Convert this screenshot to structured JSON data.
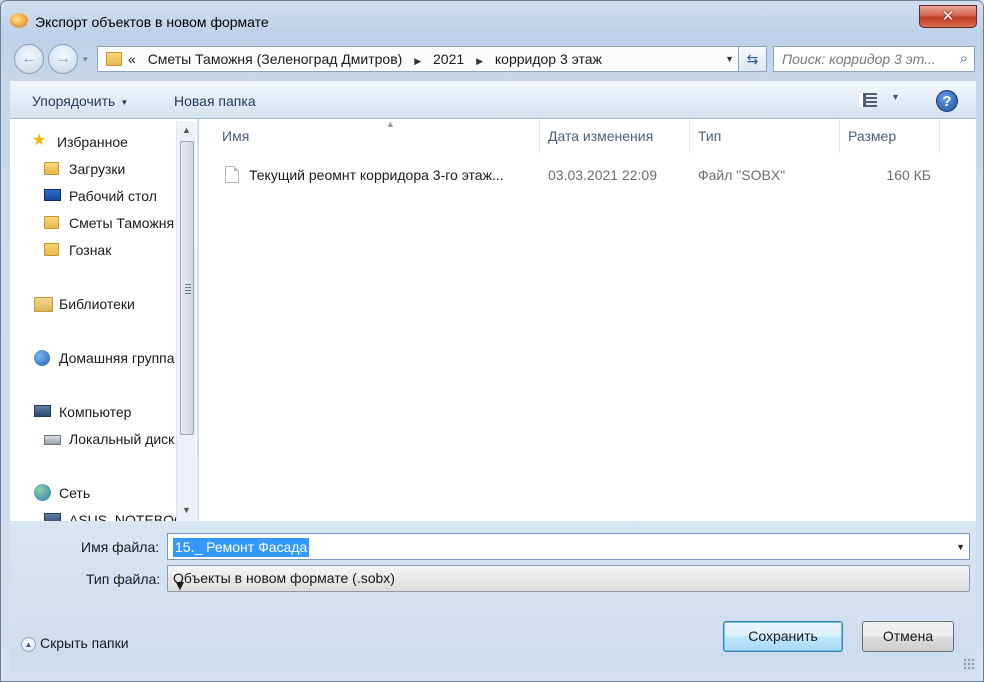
{
  "window": {
    "title": "Экспорт объектов в новом формате",
    "close_glyph": "✕",
    "accent": "#c23b25"
  },
  "nav": {
    "back_glyph": "←",
    "fwd_glyph": "→",
    "dropdown_glyph": "▾"
  },
  "address": {
    "overflow": "«",
    "crumbs": [
      "Сметы Таможня (Зеленоград Дмитров)",
      "2021",
      "корридор 3 этаж"
    ],
    "sep": "▶",
    "dropdown_glyph": "▼",
    "refresh_glyph": "⇆"
  },
  "search": {
    "placeholder": "Поиск: корридор 3 эт...",
    "icon_glyph": "⌕"
  },
  "toolbar": {
    "organize": "Упорядочить",
    "organize_caret": "▼",
    "new_folder": "Новая папка",
    "view_caret": "▼",
    "help_glyph": "?"
  },
  "sidebar": {
    "items": [
      {
        "label": "Избранное",
        "icon": "star-icon"
      },
      {
        "label": "Загрузки",
        "icon": "folder-icon"
      },
      {
        "label": "Рабочий стол",
        "icon": "desktop-icon"
      },
      {
        "label": "Сметы Таможня",
        "icon": "folder-icon"
      },
      {
        "label": "Гознак",
        "icon": "folder-icon"
      },
      {
        "label": "Библиотеки",
        "icon": "libraries-icon"
      },
      {
        "label": "Домашняя группа",
        "icon": "homegroup-icon"
      },
      {
        "label": "Компьютер",
        "icon": "computer-icon"
      },
      {
        "label": "Локальный диск",
        "icon": "drive-icon"
      },
      {
        "label": "Сеть",
        "icon": "network-icon"
      },
      {
        "label": "ASUS_NOTEBOOK",
        "icon": "computer-icon"
      }
    ],
    "scroll_up": "▲",
    "scroll_down": "▼"
  },
  "columns": {
    "name": "Имя",
    "date": "Дата изменения",
    "type": "Тип",
    "size": "Размер",
    "sort_glyph": "▲"
  },
  "files": [
    {
      "name": "Текущий реомнт корридора 3-го этаж...",
      "date": "03.03.2021 22:09",
      "type": "Файл \"SOBX\"",
      "size": "160 КБ"
    }
  ],
  "form": {
    "filename_label": "Имя файла:",
    "filename_value": "15._ Ремонт Фасада",
    "filetype_label": "Тип файла:",
    "filetype_value": "Объекты в новом формате (.sobx)",
    "dropdown_glyph": "▼"
  },
  "footer": {
    "hide_folders": "Скрыть папки",
    "hide_glyph": "▲",
    "save": "Сохранить",
    "cancel": "Отмена"
  }
}
